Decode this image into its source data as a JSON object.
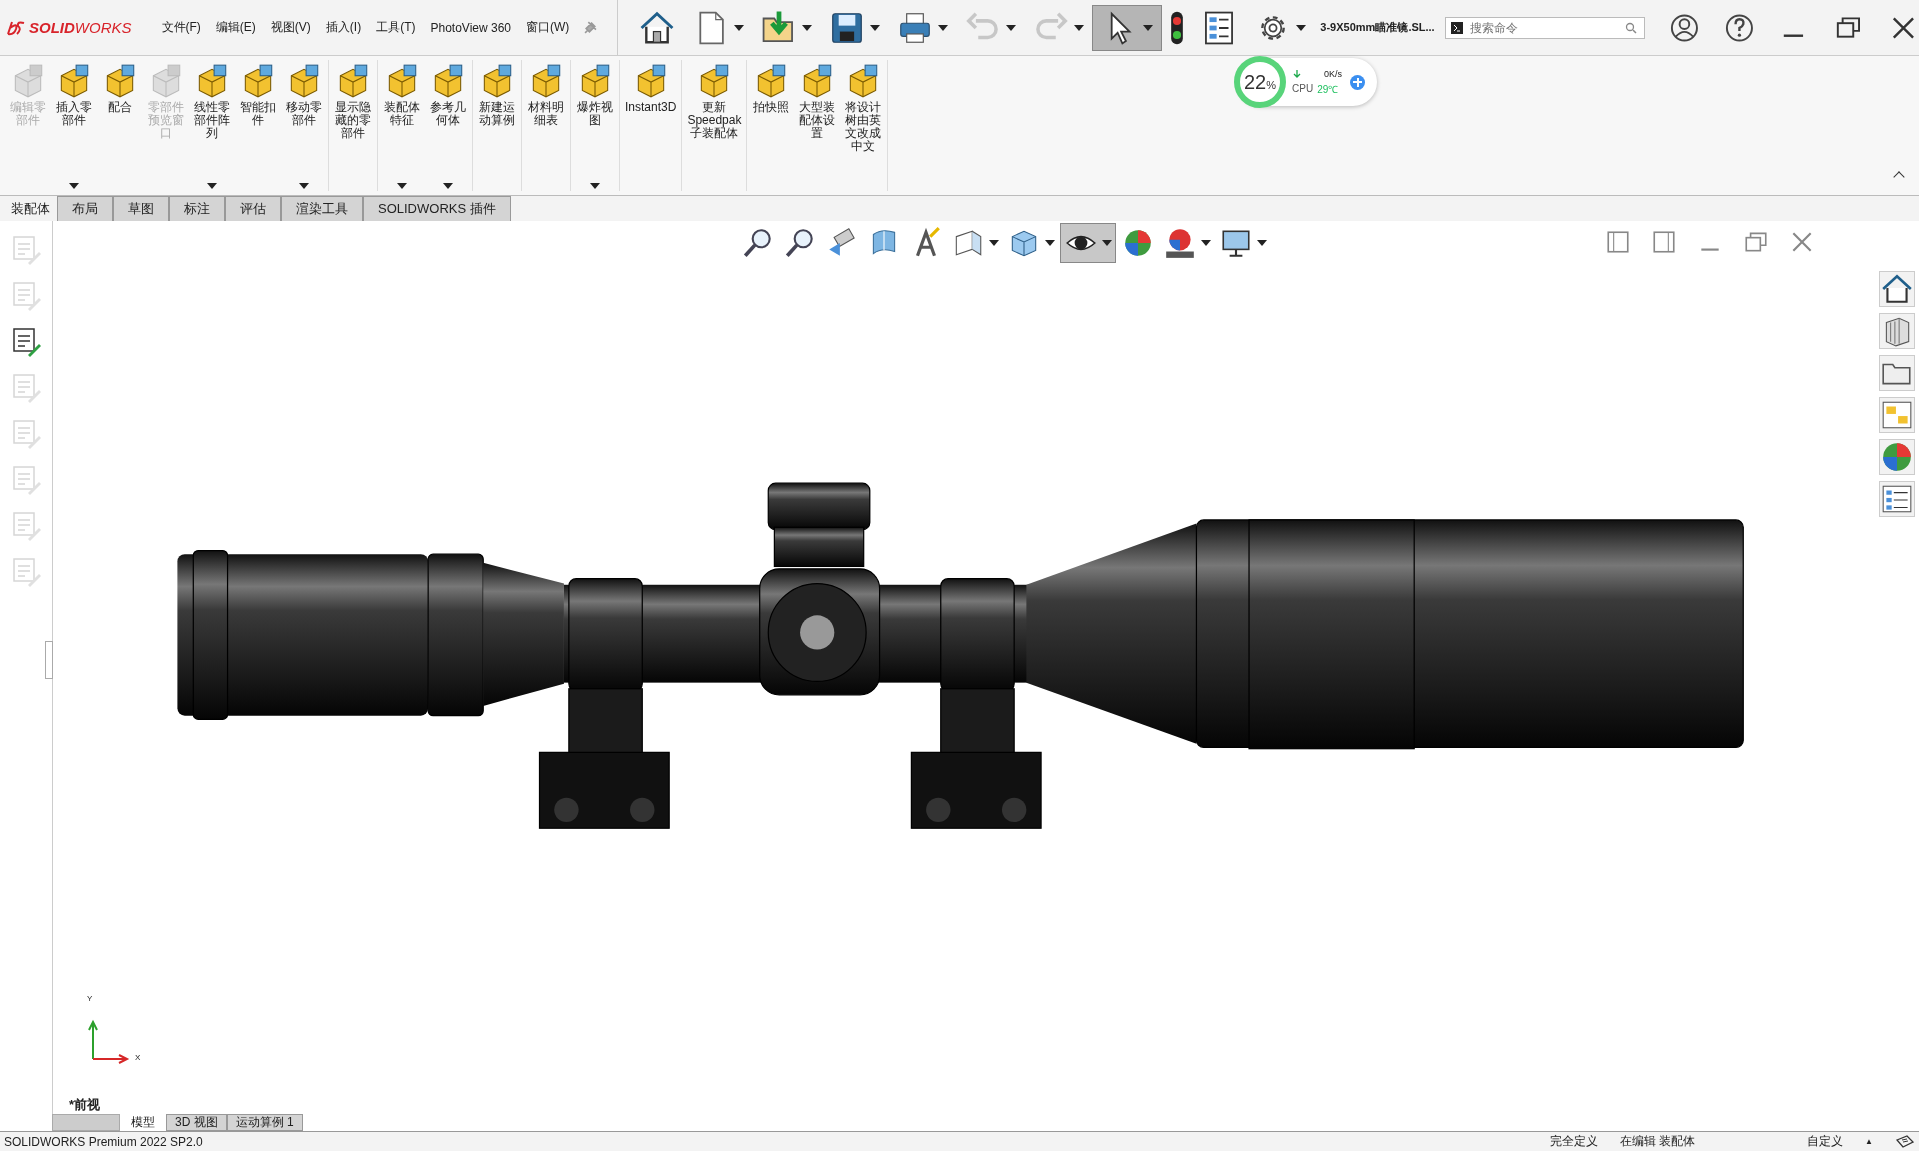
{
  "app": {
    "logo": "**SOLID**WORKS"
  },
  "menu": [
    "文件(F)",
    "编辑(E)",
    "视图(V)",
    "插入(I)",
    "工具(T)",
    "PhotoView 360",
    "窗口(W)"
  ],
  "quick_access": [
    {
      "kind": "home",
      "dropdown": false,
      "disabled": false,
      "pressed": false
    },
    {
      "kind": "new",
      "dropdown": true,
      "disabled": false,
      "pressed": false
    },
    {
      "kind": "open",
      "dropdown": true,
      "disabled": false,
      "pressed": false
    },
    {
      "kind": "save",
      "dropdown": true,
      "disabled": false,
      "pressed": false
    },
    {
      "kind": "print",
      "dropdown": true,
      "disabled": false,
      "pressed": false
    },
    {
      "kind": "undo",
      "dropdown": true,
      "disabled": true,
      "pressed": false
    },
    {
      "kind": "redo",
      "dropdown": true,
      "disabled": true,
      "pressed": false
    },
    {
      "kind": "select",
      "dropdown": true,
      "disabled": false,
      "pressed": true
    },
    {
      "kind": "traffic",
      "dropdown": false,
      "disabled": false,
      "pressed": false
    },
    {
      "kind": "list",
      "dropdown": false,
      "disabled": false,
      "pressed": false
    },
    {
      "kind": "gear",
      "dropdown": true,
      "disabled": false,
      "pressed": false
    }
  ],
  "document_title": "3-9X50mm瞄准镜.SL...",
  "search": {
    "placeholder": "搜索命令"
  },
  "cpu_widget": {
    "percent": "22",
    "unit": "%",
    "speed": "0K/s",
    "label": "CPU",
    "temperature": "29℃"
  },
  "ribbon": [
    [
      {
        "label": "编辑零部件",
        "disabled": true,
        "dropdown": false
      },
      {
        "label": "插入零部件",
        "disabled": false,
        "dropdown": true
      },
      {
        "label": "配合",
        "disabled": false,
        "dropdown": false
      },
      {
        "label": "零部件预览窗口",
        "disabled": true,
        "dropdown": false
      },
      {
        "label": "线性零部件阵列",
        "disabled": false,
        "dropdown": true
      },
      {
        "label": "智能扣件",
        "disabled": false,
        "dropdown": false
      },
      {
        "label": "移动零部件",
        "disabled": false,
        "dropdown": true
      }
    ],
    [
      {
        "label": "显示隐藏的零部件",
        "disabled": false,
        "dropdown": false
      }
    ],
    [
      {
        "label": "装配体特征",
        "disabled": false,
        "dropdown": true
      },
      {
        "label": "参考几何体",
        "disabled": false,
        "dropdown": true
      }
    ],
    [
      {
        "label": "新建运动算例",
        "disabled": false,
        "dropdown": false
      }
    ],
    [
      {
        "label": "材料明细表",
        "disabled": false,
        "dropdown": false
      }
    ],
    [
      {
        "label": "爆炸视图",
        "disabled": false,
        "dropdown": true
      }
    ],
    [
      {
        "label": "Instant3D",
        "disabled": false,
        "dropdown": false
      }
    ],
    [
      {
        "label": "更新Speedpak子装配体",
        "disabled": false,
        "dropdown": false
      }
    ],
    [
      {
        "label": "拍快照",
        "disabled": false,
        "dropdown": false
      },
      {
        "label": "大型装配体设置",
        "disabled": false,
        "dropdown": false
      },
      {
        "label": "将设计树由英文改成中文",
        "disabled": false,
        "dropdown": false
      }
    ]
  ],
  "command_tabs": [
    {
      "label": "装配体",
      "selected": true
    },
    {
      "label": "布局",
      "selected": false
    },
    {
      "label": "草图",
      "selected": false
    },
    {
      "label": "标注",
      "selected": false
    },
    {
      "label": "评估",
      "selected": false
    },
    {
      "label": "渲染工具",
      "selected": false
    },
    {
      "label": "SOLIDWORKS 插件",
      "selected": false
    }
  ],
  "left_tools": [
    {
      "disabled": true
    },
    {
      "disabled": true
    },
    {
      "disabled": false
    },
    {
      "disabled": true
    },
    {
      "disabled": true
    },
    {
      "disabled": true
    },
    {
      "disabled": true
    },
    {
      "disabled": true
    }
  ],
  "view_toolbar": [
    {
      "kind": "magnifier",
      "dropdown": false,
      "pressed": false
    },
    {
      "kind": "magnifier",
      "dropdown": false,
      "pressed": false
    },
    {
      "kind": "previous",
      "dropdown": false,
      "pressed": false
    },
    {
      "kind": "section",
      "dropdown": false,
      "pressed": false
    },
    {
      "kind": "annotation",
      "dropdown": false,
      "pressed": false
    },
    {
      "kind": "orientation",
      "dropdown": true,
      "pressed": false
    },
    {
      "kind": "cube",
      "dropdown": true,
      "pressed": false
    },
    {
      "kind": "eye",
      "dropdown": true,
      "pressed": true
    },
    {
      "kind": "sphere",
      "dropdown": false,
      "pressed": false
    },
    {
      "kind": "scene",
      "dropdown": true,
      "pressed": false
    },
    {
      "kind": "monitor",
      "dropdown": true,
      "pressed": false
    }
  ],
  "triad": {
    "y": "Y",
    "x": "X"
  },
  "view_name": "*前视",
  "model_tabs": [
    {
      "label": "模型",
      "selected": true
    },
    {
      "label": "3D 视图",
      "selected": false
    },
    {
      "label": "运动算例 1",
      "selected": false
    }
  ],
  "status_bar": {
    "product": "SOLIDWORKS Premium 2022 SP2.0",
    "state": "完全定义",
    "mode": "在编辑 装配体",
    "units": "自定义",
    "caret": "▲"
  }
}
